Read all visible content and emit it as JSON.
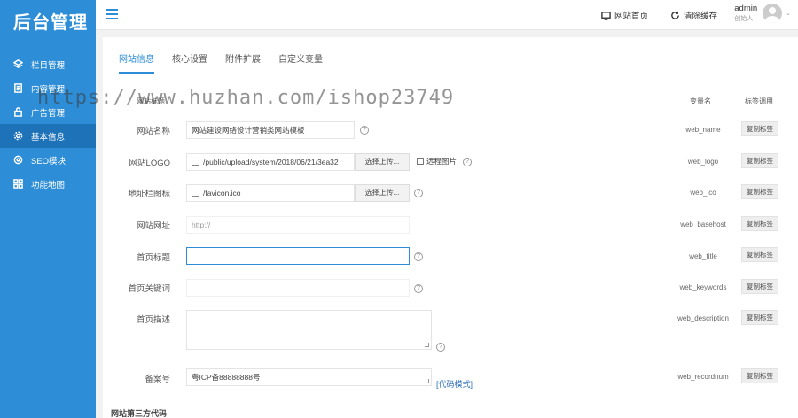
{
  "app": {
    "logo_text": "后台管理"
  },
  "sidebar": {
    "items": [
      {
        "label": "栏目管理",
        "icon": "layers-icon",
        "active": false
      },
      {
        "label": "内容管理",
        "icon": "document-icon",
        "active": false
      },
      {
        "label": "广告管理",
        "icon": "lock-icon",
        "active": false
      },
      {
        "label": "基本信息",
        "icon": "gear-icon",
        "active": true
      },
      {
        "label": "SEO模块",
        "icon": "target-icon",
        "active": false
      },
      {
        "label": "功能地图",
        "icon": "grid-icon",
        "active": false
      }
    ]
  },
  "header": {
    "home_link": "网站首页",
    "clear_cache": "清除缓存",
    "user_name": "admin",
    "user_role": "创始人",
    "caret": "⌄"
  },
  "tabs": [
    {
      "label": "网站信息",
      "active": true
    },
    {
      "label": "核心设置",
      "active": false
    },
    {
      "label": "附件扩展",
      "active": false
    },
    {
      "label": "自定义变量",
      "active": false
    }
  ],
  "table_header": {
    "title_col": "网站标题",
    "var_col": "变量名",
    "tag_col": "标签调用"
  },
  "form": {
    "rows": [
      {
        "label": "网站名称",
        "value": "网站建设网络设计营销类网站模板",
        "placeholder": "",
        "var": "web_name"
      },
      {
        "label": "网站LOGO",
        "value": "/public/upload/system/2018/06/21/3ea32",
        "placeholder": "",
        "var": "web_logo"
      },
      {
        "label": "地址栏图标",
        "value": "/favicon.ico",
        "placeholder": "",
        "var": "web_ico"
      },
      {
        "label": "网站网址",
        "value": "",
        "placeholder": "http://",
        "var": "web_basehost"
      },
      {
        "label": "首页标题",
        "value": "",
        "placeholder": "",
        "var": "web_title"
      },
      {
        "label": "首页关键词",
        "value": "",
        "placeholder": "",
        "var": "web_keywords"
      },
      {
        "label": "首页描述",
        "value": "",
        "placeholder": "",
        "var": "web_description"
      },
      {
        "label": "备案号",
        "value": "粤ICP备88888888号",
        "placeholder": "",
        "var": "web_recordnum"
      }
    ],
    "upload_label": "选择上传...",
    "remote_label": "远程图片",
    "copy_label": "复制标签",
    "help_glyph": "?",
    "code_mode": "[代码模式]",
    "section_title": "网站第三方代码"
  },
  "watermark": "https://www.huzhan.com/ishop23749",
  "colors": {
    "primary": "#2d8dd6",
    "sidebar_active": "#1d72b8"
  }
}
